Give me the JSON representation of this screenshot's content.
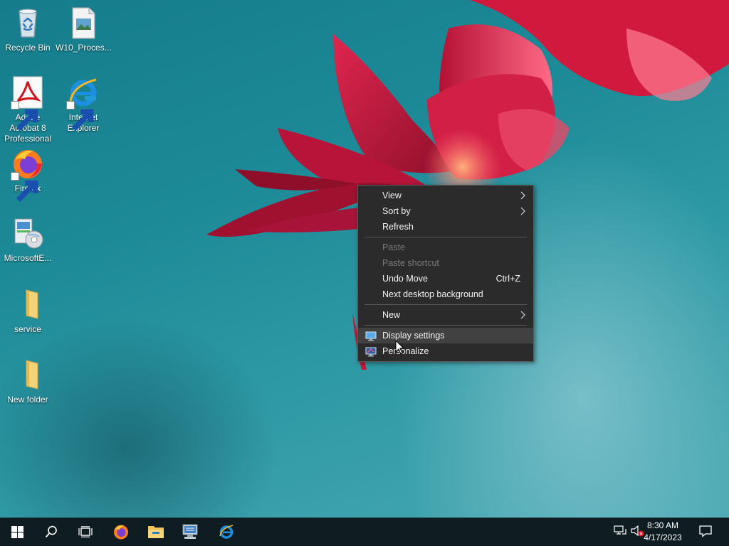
{
  "desktop_icons": [
    {
      "label": "Recycle Bin",
      "icon": "recycle-bin-icon"
    },
    {
      "label": "W10_Proces...",
      "icon": "image-file-icon"
    },
    {
      "label": "Adobe Acrobat 8 Professional",
      "icon": "adobe-acrobat-icon"
    },
    {
      "label": "Internet Explorer",
      "icon": "internet-explorer-icon"
    },
    {
      "label": "Firefox",
      "icon": "firefox-icon"
    },
    {
      "label": "MicrosoftE...",
      "icon": "installer-icon"
    },
    {
      "label": "service",
      "icon": "folder-icon"
    },
    {
      "label": "New folder",
      "icon": "folder-icon"
    }
  ],
  "context_menu": {
    "items": [
      {
        "label": "View",
        "submenu": true,
        "enabled": true
      },
      {
        "label": "Sort by",
        "submenu": true,
        "enabled": true
      },
      {
        "label": "Refresh",
        "enabled": true
      },
      {
        "label": "Paste",
        "enabled": false
      },
      {
        "label": "Paste shortcut",
        "enabled": false
      },
      {
        "label": "Undo Move",
        "shortcut": "Ctrl+Z",
        "enabled": true
      },
      {
        "label": "Next desktop background",
        "enabled": true
      },
      {
        "label": "New",
        "submenu": true,
        "enabled": true
      },
      {
        "label": "Display settings",
        "icon": "display-settings-icon",
        "enabled": true,
        "highlighted": true
      },
      {
        "label": "Personalize",
        "icon": "personalize-icon",
        "enabled": true
      }
    ]
  },
  "taskbar": {
    "buttons": [
      "start-icon",
      "search-icon",
      "task-view-icon",
      "firefox-icon",
      "file-explorer-icon",
      "network-computer-icon",
      "internet-explorer-icon"
    ],
    "clock": {
      "time": "8:30 AM",
      "date": "4/17/2023"
    },
    "tray": [
      "network-icon",
      "volume-muted-icon",
      "notifications-icon"
    ]
  },
  "colors": {
    "menu_bg": "#2b2b2b",
    "menu_hover": "#414141",
    "taskbar_bg": "#0f1c22",
    "desktop_teal": "#1d8a97",
    "flower_red": "#c8173a"
  }
}
